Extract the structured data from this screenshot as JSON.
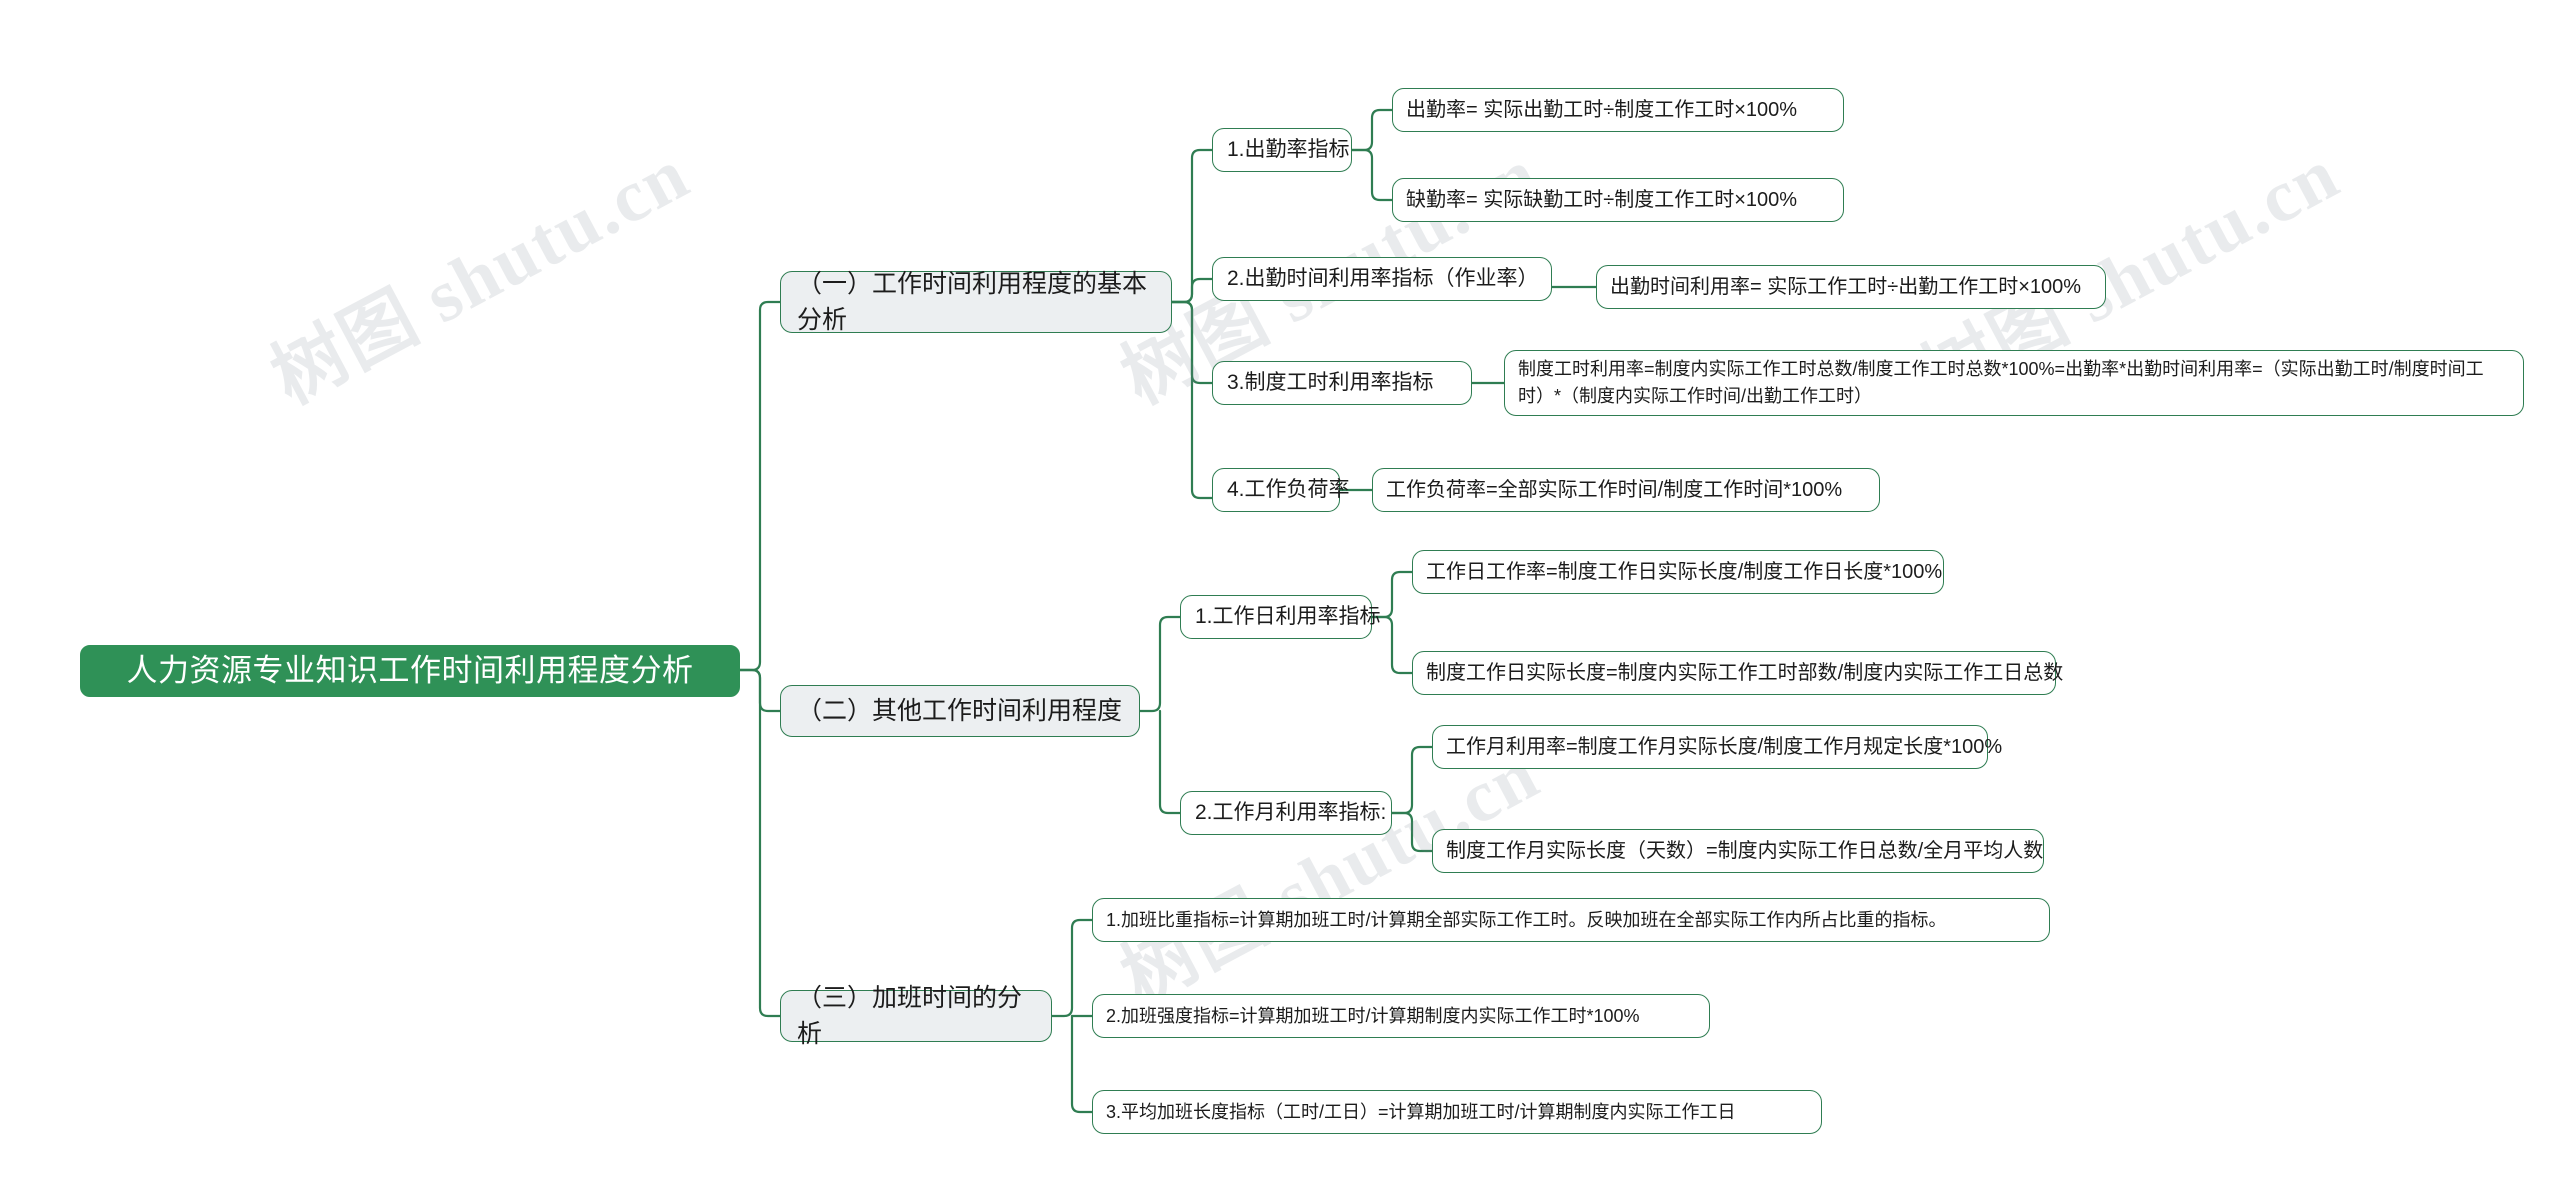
{
  "meta": {
    "title": "人力资源专业知识工作时间利用程度分析",
    "watermark_text": "树图 shutu.cn",
    "colors": {
      "root_fill": "#2f9157",
      "root_text": "#ffffff",
      "branch_fill": "#eceff1",
      "node_border": "#2f7d52",
      "node_fill": "#ffffff",
      "node_text": "#1c1c1c",
      "link_stroke": "#2f7d52",
      "background": "#ffffff"
    }
  },
  "root": {
    "label": "人力资源专业知识工作时间利用程度分析"
  },
  "branches": [
    {
      "label": "（一）工作时间利用程度的基本分析",
      "children": [
        {
          "label": "1.出勤率指标",
          "leaves": [
            {
              "text": "出勤率= 实际出勤工时÷制度工作工时×100%"
            },
            {
              "text": "缺勤率= 实际缺勤工时÷制度工作工时×100%"
            }
          ]
        },
        {
          "label": "2.出勤时间利用率指标（作业率）",
          "leaves": [
            {
              "text": "出勤时间利用率= 实际工作工时÷出勤工作工时×100%"
            }
          ]
        },
        {
          "label": "3.制度工时利用率指标",
          "leaves": [
            {
              "text": "制度工时利用率=制度内实际工作工时总数/制度工作工时总数*100%=出勤率*出勤时间利用率=（实际出勤工时/制度时间工时）*（制度内实际工作时间/出勤工作工时）"
            }
          ]
        },
        {
          "label": "4.工作负荷率",
          "leaves": [
            {
              "text": "工作负荷率=全部实际工作时间/制度工作时间*100%"
            }
          ]
        }
      ]
    },
    {
      "label": "（二）其他工作时间利用程度",
      "children": [
        {
          "label": "1.工作日利用率指标",
          "leaves": [
            {
              "text": "工作日工作率=制度工作日实际长度/制度工作日长度*100%"
            },
            {
              "text": "制度工作日实际长度=制度内实际工作工时部数/制度内实际工作工日总数"
            }
          ]
        },
        {
          "label": "2.工作月利用率指标:",
          "leaves": [
            {
              "text": "工作月利用率=制度工作月实际长度/制度工作月规定长度*100%"
            },
            {
              "text": "制度工作月实际长度（天数）=制度内实际工作日总数/全月平均人数"
            }
          ]
        }
      ]
    },
    {
      "label": "（三）加班时间的分析",
      "children": [
        {
          "label": "1.加班比重指标=计算期加班工时/计算期全部实际工作工时。反映加班在全部实际工作内所占比重的指标。",
          "leaves": []
        },
        {
          "label": "2.加班强度指标=计算期加班工时/计算期制度内实际工作工时*100%",
          "leaves": []
        },
        {
          "label": "3.平均加班长度指标（工时/工日）=计算期加班工时/计算期制度内实际工作工日",
          "leaves": []
        }
      ]
    }
  ]
}
